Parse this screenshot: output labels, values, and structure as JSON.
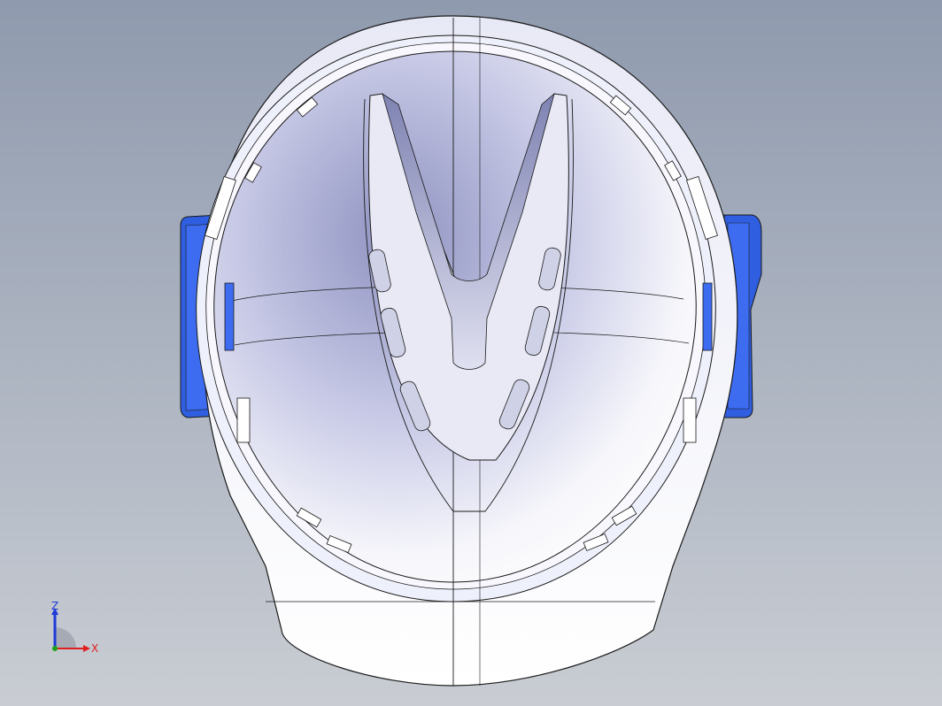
{
  "viewport": {
    "model": "helmet-bottom-view",
    "background_top": "#8f9aae",
    "background_bottom": "#c9cdd3",
    "shell_color": "#ffffff",
    "inner_shade": "#b8bbdc",
    "accent_color": "#2f5fe0",
    "edge_color": "#1a1a1a"
  },
  "triad": {
    "z_label": "Z",
    "x_label": "X",
    "z_color": "#1e3ad8",
    "x_color": "#e02020",
    "y_color": "#1aa01a"
  }
}
